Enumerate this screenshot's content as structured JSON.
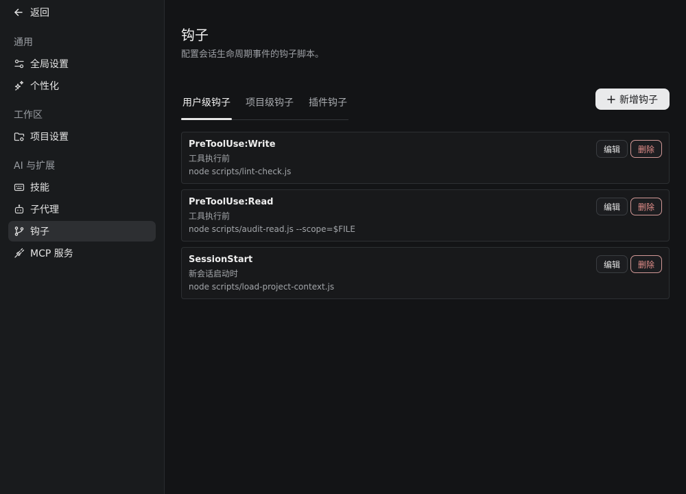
{
  "sidebar": {
    "back_label": "返回",
    "sections": {
      "general": "通用",
      "workspace": "工作区",
      "ai": "AI 与扩展"
    },
    "items": [
      {
        "label": "全局设置",
        "icon": "sliders-icon"
      },
      {
        "label": "个性化",
        "icon": "sparkles-icon"
      },
      {
        "label": "项目设置",
        "icon": "folder-settings-icon"
      },
      {
        "label": "技能",
        "icon": "keyboard-icon"
      },
      {
        "label": "子代理",
        "icon": "bot-icon"
      },
      {
        "label": "钩子",
        "icon": "git-branch-icon",
        "active": true
      },
      {
        "label": "MCP 服务",
        "icon": "plug-icon"
      }
    ]
  },
  "main": {
    "title": "钩子",
    "description": "配置会话生命周期事件的钩子脚本。",
    "tabs": [
      {
        "label": "用户级钩子",
        "active": true
      },
      {
        "label": "项目级钩子"
      },
      {
        "label": "插件钩子"
      }
    ],
    "add_button_label": "新增钩子",
    "hooks": [
      {
        "name": "PreToolUse:Write",
        "desc": "工具执行前",
        "command": "node scripts/lint-check.js"
      },
      {
        "name": "PreToolUse:Read",
        "desc": "工具执行前",
        "command": "node scripts/audit-read.js --scope=$FILE"
      },
      {
        "name": "SessionStart",
        "desc": "新会话启动时",
        "command": "node scripts/load-project-context.js"
      }
    ],
    "edit_label": "编辑",
    "delete_label": "删除"
  },
  "colors": {
    "background": "#131416",
    "sidebar": "#191b1d",
    "active_item": "#2d2f32",
    "danger": "#e58f8b"
  }
}
